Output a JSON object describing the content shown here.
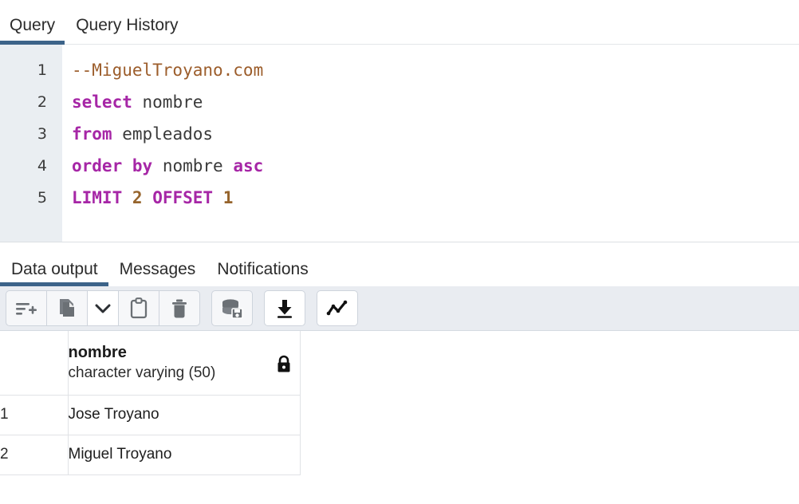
{
  "top_tabs": [
    {
      "label": "Query",
      "active": true
    },
    {
      "label": "Query History",
      "active": false
    }
  ],
  "editor": {
    "line_numbers": [
      "1",
      "2",
      "3",
      "4",
      "5"
    ],
    "lines": [
      {
        "n": "1",
        "tokens": [
          {
            "t": "comment",
            "s": "--MiguelTroyano.com"
          }
        ]
      },
      {
        "n": "2",
        "tokens": [
          {
            "t": "keyword",
            "s": "select"
          },
          {
            "t": "plain",
            "s": " "
          },
          {
            "t": "ident",
            "s": "nombre"
          }
        ]
      },
      {
        "n": "3",
        "tokens": [
          {
            "t": "keyword",
            "s": "from"
          },
          {
            "t": "plain",
            "s": " "
          },
          {
            "t": "ident",
            "s": "empleados"
          }
        ]
      },
      {
        "n": "4",
        "tokens": [
          {
            "t": "keyword",
            "s": "order"
          },
          {
            "t": "plain",
            "s": " "
          },
          {
            "t": "keyword",
            "s": "by"
          },
          {
            "t": "plain",
            "s": " "
          },
          {
            "t": "ident",
            "s": "nombre"
          },
          {
            "t": "plain",
            "s": " "
          },
          {
            "t": "keyword",
            "s": "asc"
          }
        ]
      },
      {
        "n": "5",
        "tokens": [
          {
            "t": "keyword",
            "s": "LIMIT"
          },
          {
            "t": "plain",
            "s": " "
          },
          {
            "t": "number",
            "s": "2"
          },
          {
            "t": "plain",
            "s": " "
          },
          {
            "t": "keyword",
            "s": "OFFSET"
          },
          {
            "t": "plain",
            "s": " "
          },
          {
            "t": "number",
            "s": "1"
          }
        ]
      }
    ],
    "text": "--MiguelTroyano.com\nselect nombre\nfrom empleados\norder by nombre asc\nLIMIT 2 OFFSET 1"
  },
  "panel_tabs": [
    {
      "label": "Data output",
      "active": true
    },
    {
      "label": "Messages",
      "active": false
    },
    {
      "label": "Notifications",
      "active": false
    }
  ],
  "results_toolbar": {
    "groups": [
      {
        "buttons": [
          {
            "icon": "add-row-icon",
            "style": "gray"
          },
          {
            "icon": "copy-icon",
            "style": "gray"
          },
          {
            "icon": "chevron-down-icon",
            "style": "chevron"
          },
          {
            "icon": "paste-icon",
            "style": "gray"
          },
          {
            "icon": "delete-icon",
            "style": "gray"
          }
        ]
      },
      {
        "buttons": [
          {
            "icon": "save-data-changes-icon",
            "style": "gray"
          }
        ]
      },
      {
        "buttons": [
          {
            "icon": "download-icon",
            "style": "light"
          }
        ]
      },
      {
        "buttons": [
          {
            "icon": "graph-visualiser-icon",
            "style": "light"
          }
        ]
      }
    ]
  },
  "grid": {
    "columns": [
      {
        "name": "nombre",
        "type": "character varying (50)",
        "locked": true
      }
    ],
    "rows": [
      {
        "num": "1",
        "values": [
          "Jose Troyano"
        ]
      },
      {
        "num": "2",
        "values": [
          "Miguel Troyano"
        ]
      }
    ]
  },
  "colors": {
    "accent": "#3c6389",
    "toolbar_bg": "#e9ecf1",
    "gutter_bg": "#eaeef2",
    "keyword": "#a626a6",
    "comment": "#9c5d2b",
    "number": "#96642c",
    "grid_border": "#e0e2e6"
  }
}
